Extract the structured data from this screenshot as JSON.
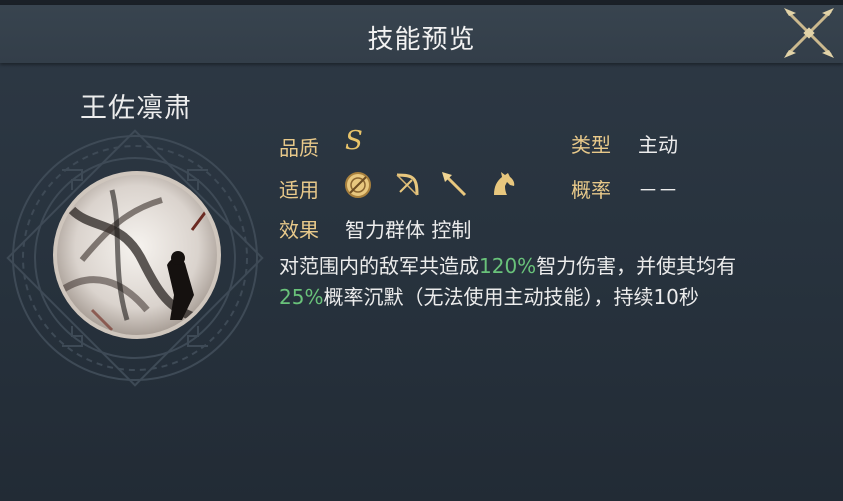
{
  "header": {
    "title": "技能预览"
  },
  "skill": {
    "name": "王佐凛肃",
    "quality_label": "品质",
    "quality_value": "S",
    "type_label": "类型",
    "type_value": "主动",
    "applicable_label": "适用",
    "applicable_icons": [
      "shield-icon",
      "bow-icon",
      "spear-icon",
      "horse-icon"
    ],
    "probability_label": "概率",
    "probability_value": "－－",
    "effect_label": "效果",
    "effect_tags": "智力群体 控制",
    "description": {
      "part1": "对范围内的敌军共造成",
      "damage_pct": "120%",
      "part2": "智力伤害，并使其均有",
      "chance_pct": "25%",
      "part3": "概率沉默（无法使用主动技能），持续10秒"
    }
  },
  "colors": {
    "label": "#e8c98a",
    "highlight": "#69c27a",
    "quality": "#e8c46a",
    "background": "#27323d"
  }
}
